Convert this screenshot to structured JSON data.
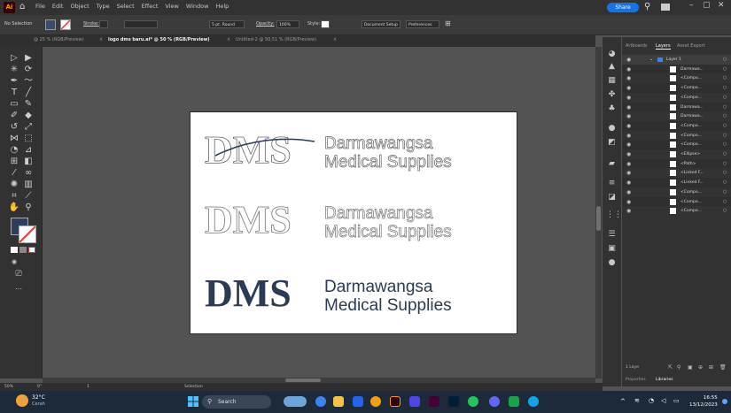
{
  "app": {
    "logo_text": "Ai",
    "menu": [
      "File",
      "Edit",
      "Object",
      "Type",
      "Select",
      "Effect",
      "View",
      "Window",
      "Help"
    ],
    "share_label": "Share"
  },
  "control_bar": {
    "selection_label": "No Selection",
    "stroke_label": "Stroke:",
    "brush_label": "5 pt. Round",
    "opacity_label": "Opacity:",
    "opacity_value": "100%",
    "style_label": "Style:",
    "doc_setup_label": "Document Setup",
    "preferences_label": "Preferences"
  },
  "tabs": [
    {
      "label": "@ 25 % (RGB/Preview)",
      "active": false
    },
    {
      "label": "logo dms baru.ai* @ 50 % (RGB/Preview)",
      "active": true
    },
    {
      "label": "Untitled-2 @ 50,51 % (RGB/Preview)",
      "active": false
    }
  ],
  "artboard": {
    "logos": [
      {
        "mark": "DMS",
        "line1": "Darmawangsa",
        "line2": "Medical Supplies",
        "style": "outline-swoosh"
      },
      {
        "mark": "DMS",
        "line1": "Darmawangsa",
        "line2": "Medical Supplies",
        "style": "outline"
      },
      {
        "mark": "DMS",
        "line1": "Darmawangsa",
        "line2": "Medical Supplies",
        "style": "solid"
      }
    ],
    "brand_color": "#2b3a55"
  },
  "layers_panel": {
    "tabs": [
      "Artboards",
      "Layers",
      "Asset Export"
    ],
    "active_tab": "Layers",
    "rows": [
      {
        "name": "Layer 1",
        "top": true
      },
      {
        "name": "Darmawa..."
      },
      {
        "name": "<Compo..."
      },
      {
        "name": "<Compo..."
      },
      {
        "name": "<Compo..."
      },
      {
        "name": "Darmawa..."
      },
      {
        "name": "Darmawa..."
      },
      {
        "name": "<Compo..."
      },
      {
        "name": "<Compo..."
      },
      {
        "name": "<Compo..."
      },
      {
        "name": "<Ellipse>"
      },
      {
        "name": "<Path>"
      },
      {
        "name": "<Linked F..."
      },
      {
        "name": "<Linked F..."
      },
      {
        "name": "<Compo..."
      },
      {
        "name": "<Compo..."
      },
      {
        "name": "<Compo..."
      }
    ],
    "footer_count": "1 Laye",
    "bottom_tabs": [
      "Properties",
      "Libraries"
    ]
  },
  "status_bar": {
    "zoom": "50%",
    "rotation": "0°",
    "artboard_nav": "1",
    "tool": "Selection"
  },
  "taskbar": {
    "temperature": "32°C",
    "weather_desc": "Cerah",
    "search_placeholder": "Search",
    "time": "16:55",
    "date": "13/12/2023"
  }
}
